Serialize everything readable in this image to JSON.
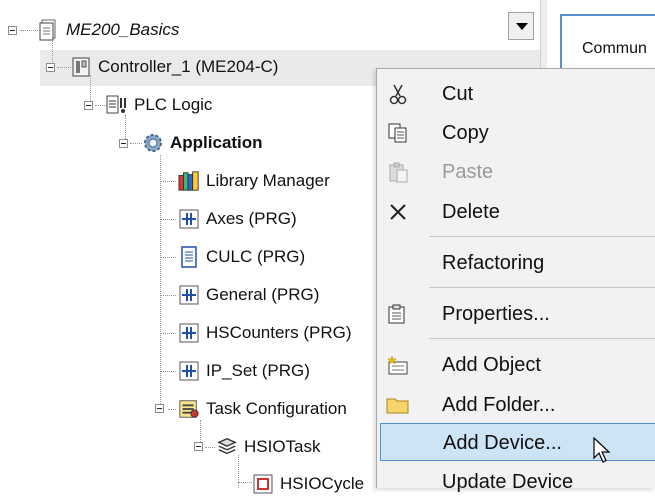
{
  "tree": {
    "root": {
      "label": "ME200_Basics"
    },
    "controller": {
      "label": "Controller_1 (ME204-C)"
    },
    "plc_logic": {
      "label": "PLC Logic"
    },
    "application": {
      "label": "Application"
    },
    "children": [
      {
        "label": "Library Manager",
        "icon": "library-icon"
      },
      {
        "label": "Axes (PRG)",
        "icon": "program-icon"
      },
      {
        "label": "CULC (PRG)",
        "icon": "document-icon"
      },
      {
        "label": "General (PRG)",
        "icon": "program-icon"
      },
      {
        "label": "HSCounters (PRG)",
        "icon": "program-icon"
      },
      {
        "label": "IP_Set (PRG)",
        "icon": "program-icon"
      },
      {
        "label": "Task Configuration",
        "icon": "task-config-icon"
      }
    ],
    "task": {
      "label": "HSIOTask"
    },
    "task_child": {
      "label": "HSIOCycle"
    }
  },
  "right_panel": {
    "label": "Commun"
  },
  "context_menu": {
    "items": [
      {
        "label": "Cut",
        "icon": "scissors-icon",
        "disabled": false
      },
      {
        "label": "Copy",
        "icon": "copy-icon",
        "disabled": false
      },
      {
        "label": "Paste",
        "icon": "paste-icon",
        "disabled": true
      },
      {
        "label": "Delete",
        "icon": "delete-x-icon",
        "disabled": false
      },
      {
        "label": "Refactoring",
        "icon": "",
        "disabled": false
      },
      {
        "label": "Properties...",
        "icon": "properties-icon",
        "disabled": false
      },
      {
        "label": "Add Object",
        "icon": "add-object-icon",
        "disabled": false
      },
      {
        "label": "Add Folder...",
        "icon": "folder-icon",
        "disabled": false
      },
      {
        "label": "Add Device...",
        "icon": "",
        "disabled": false,
        "highlighted": true
      },
      {
        "label": "Update Device",
        "icon": "",
        "disabled": false
      }
    ]
  },
  "colors": {
    "menu_bg": "#f2f2f2",
    "highlight_bg": "#cde4f7",
    "highlight_border": "#4d8fd1",
    "disabled_text": "#9a9a9a",
    "selection_row": "#eaeaea"
  }
}
